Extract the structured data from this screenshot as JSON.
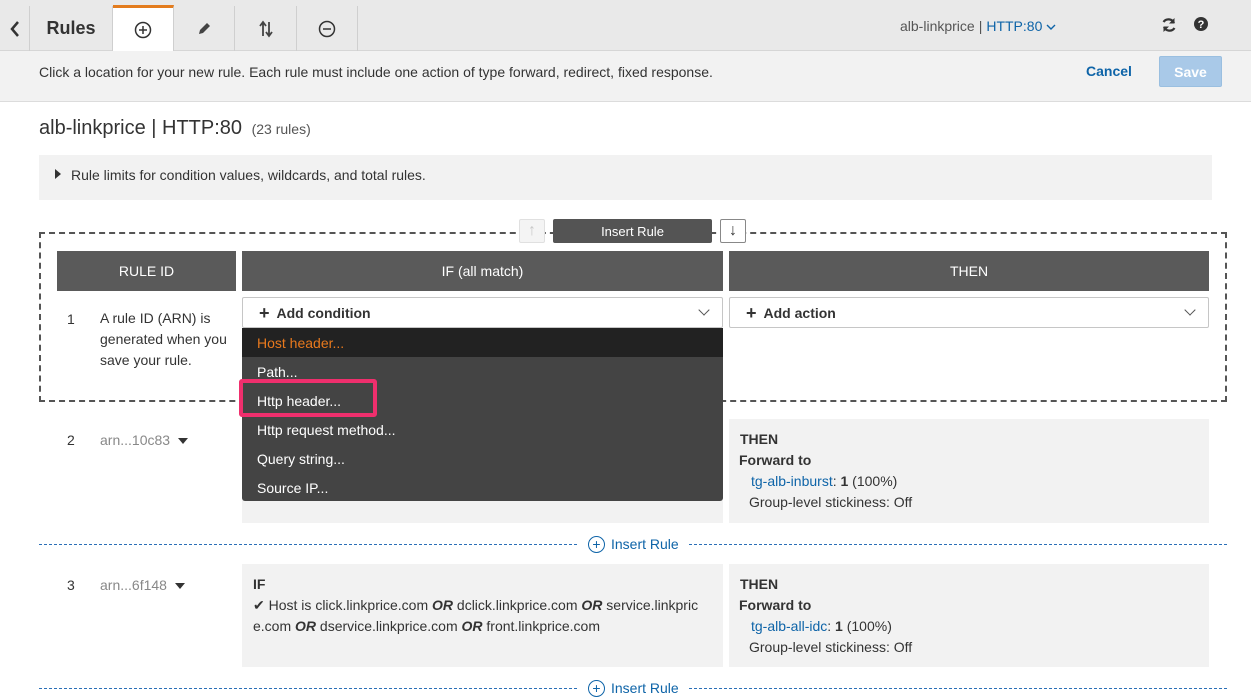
{
  "tabs": {
    "back_icon": "chevron-left-icon",
    "rules_label": "Rules",
    "add_icon": "plus-circle-icon",
    "edit_icon": "pencil-icon",
    "reorder_icon": "reorder-arrows-icon",
    "remove_icon": "minus-circle-icon",
    "active_tab": "add"
  },
  "listener": {
    "lb_name": "alb-linkprice",
    "separator": "|",
    "port": "HTTP:80"
  },
  "instruction": {
    "text": "Click a location for your new rule. Each rule must include one action of type forward, redirect, fixed response.",
    "cancel_label": "Cancel",
    "save_label": "Save"
  },
  "page": {
    "title": "alb-linkprice | HTTP:80",
    "rule_count": "(23 rules)",
    "limits_text": "Rule limits for condition values, wildcards, and total rules."
  },
  "insert_widget": {
    "up_arrow": "↑",
    "label": "Insert Rule",
    "down_arrow": "↓"
  },
  "columns": {
    "rule_id": "RULE ID",
    "if": "IF (all match)",
    "then": "THEN"
  },
  "new_rule": {
    "number": "1",
    "description": "A rule ID (ARN) is generated when you save your rule.",
    "add_condition": "Add condition",
    "add_action": "Add action"
  },
  "condition_menu": {
    "items": [
      "Host header...",
      "Path...",
      "Http header...",
      "Http request method...",
      "Query string...",
      "Source IP..."
    ],
    "active_index": 0,
    "highlighted_index": 2
  },
  "rules": [
    {
      "number": "2",
      "arn": "arn...10c83",
      "then_label": "THEN",
      "action": "Forward to",
      "target": "tg-alb-inburst",
      "weight": "1",
      "percent": "(100%)",
      "stickiness": "Group-level stickiness: Off"
    },
    {
      "number": "3",
      "arn": "arn...6f148",
      "if_label": "IF",
      "host_line1_prefix": "Host is",
      "host1": "click.linkprice.com",
      "or": "OR",
      "host2": "dclick.linkprice.com",
      "host3_part1": "service.linkpric",
      "host3_part2": "e.com",
      "host4": "dservice.linkprice.com",
      "host5": "front.linkprice.com",
      "then_label": "THEN",
      "action": "Forward to",
      "target": "tg-alb-all-idc",
      "weight": "1",
      "percent": "(100%)",
      "stickiness": "Group-level stickiness: Off"
    }
  ],
  "insert_rule_link": "Insert Rule",
  "colors": {
    "accent_orange": "#e8791d",
    "link_blue": "#0e64a8",
    "header_gray": "#5a5a5a",
    "highlight_pink": "#ef2f6d"
  }
}
